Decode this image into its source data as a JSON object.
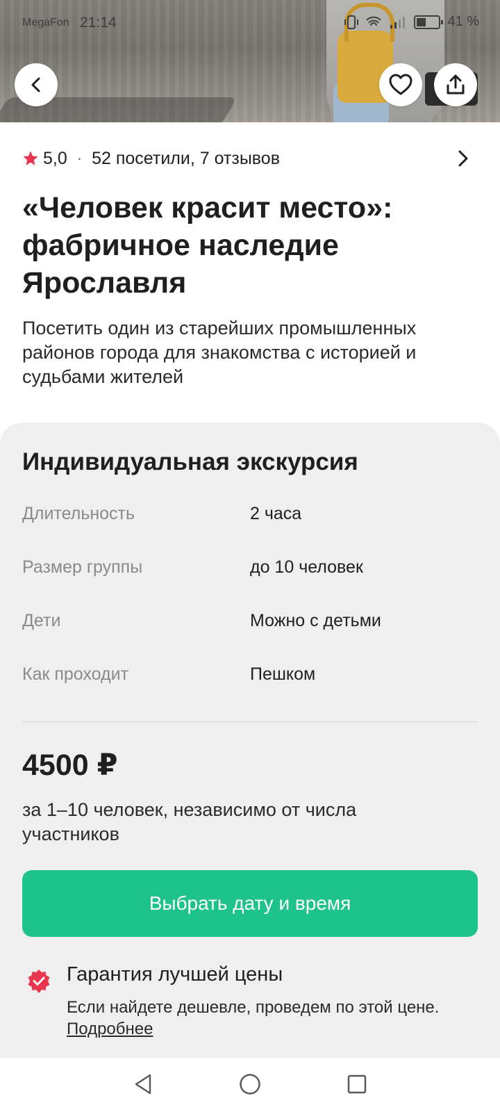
{
  "status_bar": {
    "carrier": "MegaFon",
    "time": "21:14",
    "battery": "41 %",
    "battery_level": 0.41
  },
  "hero": {
    "back_icon": "chevron-left-icon",
    "favorite_icon": "heart-icon",
    "share_icon": "share-icon"
  },
  "rating": {
    "value": "5,0",
    "separator": "·",
    "visits_reviews": "52 посетили, 7 отзывов",
    "star_color": "#e8364f"
  },
  "tour": {
    "title": "«Человек красит место»: фабричное наследие Ярославля",
    "subtitle": "Посетить один из старейших промышленных районов города для знакомства с историей и судьбами жителей"
  },
  "booking": {
    "title": "Индивидуальная экскурсия",
    "details": [
      {
        "label": "Длительность",
        "value": "2 часа"
      },
      {
        "label": "Размер группы",
        "value": "до 10 человек"
      },
      {
        "label": "Дети",
        "value": "Можно с детьми"
      },
      {
        "label": "Как проходит",
        "value": "Пешком"
      }
    ],
    "price": "4500 ₽",
    "price_note": "за 1–10 человек, независимо от числа участников",
    "cta_label": "Выбрать дату и время",
    "cta_color": "#1ec28b"
  },
  "guarantee": {
    "title": "Гарантия лучшей цены",
    "text": "Если найдете дешевле, проведем по этой цене.",
    "link": "Подробнее",
    "icon_color": "#e8364f"
  },
  "nav": {
    "back": "nav-back-icon",
    "home": "nav-home-icon",
    "recents": "nav-recents-icon"
  }
}
